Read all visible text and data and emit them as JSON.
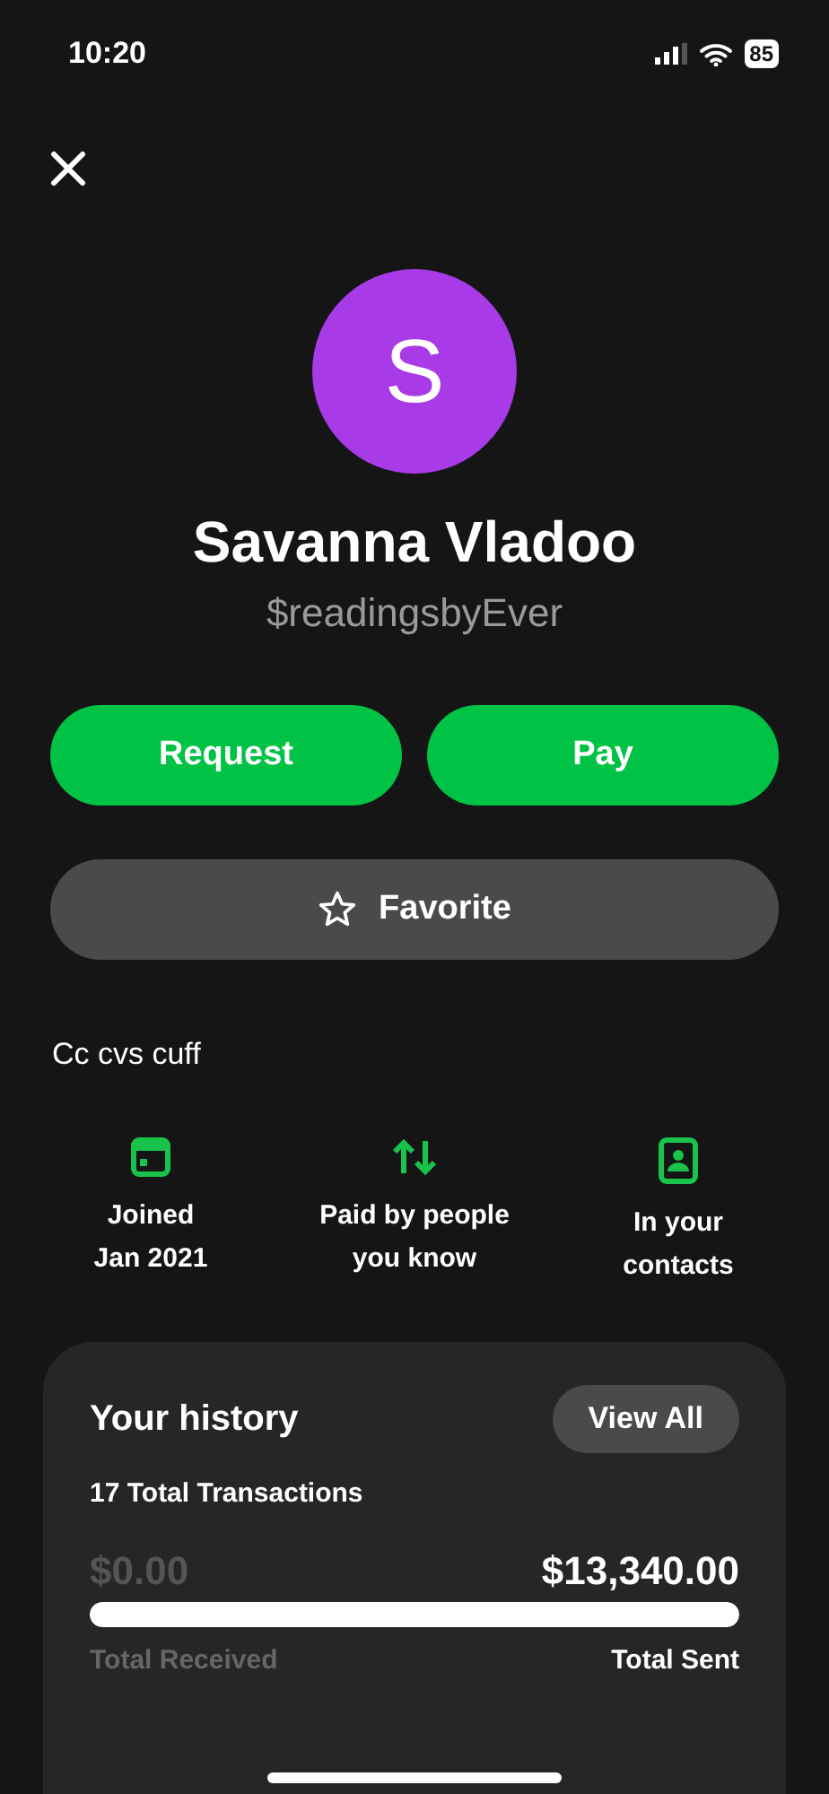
{
  "status_bar": {
    "time": "10:20",
    "battery": "85"
  },
  "profile": {
    "initial": "S",
    "name": "Savanna Vladoo",
    "handle": "$readingsbyEver"
  },
  "actions": [
    {
      "label": "Request"
    },
    {
      "label": "Pay"
    }
  ],
  "favorite": {
    "label": "Favorite",
    "selected": false
  },
  "bio": "Cc cvs cuff",
  "facts": [
    {
      "kind": "calendar",
      "lines": [
        "Joined",
        "Jan 2021"
      ]
    },
    {
      "kind": "arrows",
      "lines": [
        "Paid by people",
        "you know"
      ]
    },
    {
      "kind": "contact",
      "lines": [
        "In your",
        "contacts"
      ]
    }
  ],
  "history": {
    "title": "Your history",
    "button": "View All",
    "transactions": "17 Total Transactions",
    "received_amount": "$0.00",
    "sent_amount": "$13,340.00",
    "level": 1,
    "received_label": "Total Received",
    "sent_label": "Total Sent"
  }
}
